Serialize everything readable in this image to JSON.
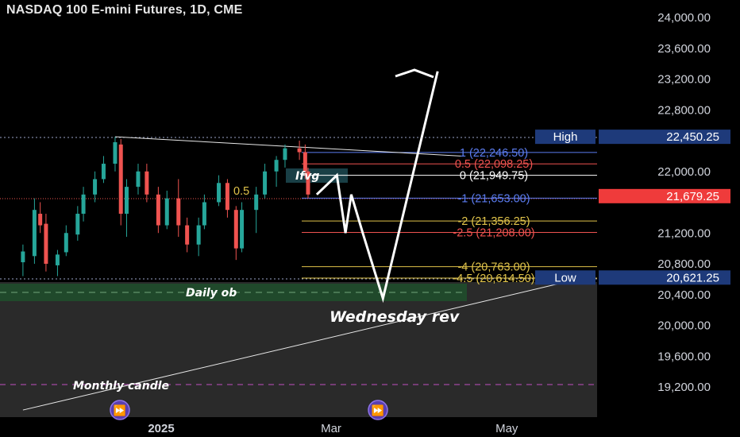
{
  "title": "NASDAQ 100 E-mini Futures, 1D, CME",
  "colors": {
    "background": "#000000",
    "pane": "#2a2a2a",
    "up": "#26a69a",
    "down": "#ef5350",
    "fib_blue": "#5b7cf0",
    "fib_white": "#ffffff",
    "fib_red": "#ef5350",
    "fib_yellow": "#e0c34a",
    "ob_zone": "#1f4d2b",
    "tag_blue": "#1e3a7a",
    "tag_red": "#ef3b3b"
  },
  "chart_data": {
    "type": "candlestick",
    "y_axis": {
      "min": 18900,
      "max": 24200,
      "ticks": [
        "24,000.00",
        "23,600.00",
        "23,200.00",
        "22,800.00",
        "22,000.00",
        "21,200.00",
        "20,800.00",
        "20,400.00",
        "20,000.00",
        "19,600.00",
        "19,200.00"
      ],
      "tick_values": [
        24000,
        23600,
        23200,
        22800,
        22000,
        21200,
        20800,
        20400,
        20000,
        19600,
        19200
      ]
    },
    "x_axis": {
      "labels": [
        "2025",
        "Mar",
        "May"
      ],
      "label_dates": [
        "2025-01-01",
        "2025-03-01",
        "2025-05-01"
      ],
      "range": [
        "2024-11-14",
        "2025-05-20"
      ]
    },
    "price_tags": [
      {
        "label": "High",
        "value_text": "22,450.25",
        "value": 22450.25,
        "style": "blue"
      },
      {
        "label": "",
        "value_text": "21,679.25",
        "value": 21679.25,
        "style": "red"
      },
      {
        "label": "Low",
        "value_text": "20,621.25",
        "value": 20621.25,
        "style": "blue"
      }
    ],
    "fib_levels": [
      {
        "text": "1 (22,246.50)",
        "value": 22246.5,
        "color": "blue"
      },
      {
        "text": "0.5 (22,098.25)",
        "value": 22098.25,
        "color": "red"
      },
      {
        "text": "0 (21,949.75)",
        "value": 21949.75,
        "color": "white"
      },
      {
        "text": "-1 (21,653.00)",
        "value": 21653.0,
        "color": "blue"
      },
      {
        "text": "-2 (21,356.25)",
        "value": 21356.25,
        "color": "yellow"
      },
      {
        "text": "-2.5 (21,208.00)",
        "value": 21208.0,
        "color": "red"
      },
      {
        "text": "-4 (20,763.00)",
        "value": 20763.0,
        "color": "yellow"
      },
      {
        "text": "-4.5 (20,614.50)",
        "value": 20614.5,
        "color": "yellow"
      }
    ],
    "annotations": [
      {
        "text": "Daily ob"
      },
      {
        "text": "Wednesday rev"
      },
      {
        "text": "Monthly candle"
      },
      {
        "text": "Ifvg"
      },
      {
        "text": "0.5"
      }
    ],
    "projection_path": [
      [
        "2025-02-24",
        21700
      ],
      [
        "2025-03-03",
        21950
      ],
      [
        "2025-03-06",
        21200
      ],
      [
        "2025-03-08",
        21700
      ],
      [
        "2025-03-12",
        21200
      ],
      [
        "2025-03-19",
        20350
      ],
      [
        "2025-04-07",
        23300
      ]
    ],
    "trendlines": [
      {
        "name": "resistance",
        "from": [
          "2024-12-16",
          22450
        ],
        "to": [
          "2025-04-15",
          22200
        ]
      },
      {
        "name": "support",
        "from": [
          "2024-11-14",
          18900
        ],
        "to": [
          "2025-05-20",
          20550
        ]
      }
    ],
    "candles": [
      {
        "date": "2024-11-14",
        "open": 20820,
        "high": 21050,
        "low": 20640,
        "close": 20960
      },
      {
        "date": "2024-11-18",
        "open": 20900,
        "high": 21650,
        "low": 20800,
        "close": 21500
      },
      {
        "date": "2024-11-20",
        "open": 21450,
        "high": 21600,
        "low": 21200,
        "close": 21300
      },
      {
        "date": "2024-11-22",
        "open": 21320,
        "high": 21450,
        "low": 20700,
        "close": 20800
      },
      {
        "date": "2024-11-26",
        "open": 20780,
        "high": 20980,
        "low": 20640,
        "close": 20920
      },
      {
        "date": "2024-11-29",
        "open": 20950,
        "high": 21300,
        "low": 20900,
        "close": 21200
      },
      {
        "date": "2024-12-03",
        "open": 21180,
        "high": 21550,
        "low": 21100,
        "close": 21450
      },
      {
        "date": "2024-12-05",
        "open": 21450,
        "high": 21800,
        "low": 21350,
        "close": 21700
      },
      {
        "date": "2024-12-09",
        "open": 21700,
        "high": 22000,
        "low": 21600,
        "close": 21900
      },
      {
        "date": "2024-12-12",
        "open": 21900,
        "high": 22200,
        "low": 21850,
        "close": 22100
      },
      {
        "date": "2024-12-16",
        "open": 22100,
        "high": 22450,
        "low": 22000,
        "close": 22380
      },
      {
        "date": "2024-12-18",
        "open": 22350,
        "high": 22420,
        "low": 21300,
        "close": 21450
      },
      {
        "date": "2024-12-20",
        "open": 21450,
        "high": 21900,
        "low": 21150,
        "close": 21800
      },
      {
        "date": "2024-12-24",
        "open": 21800,
        "high": 22100,
        "low": 21700,
        "close": 22000
      },
      {
        "date": "2024-12-27",
        "open": 22000,
        "high": 22100,
        "low": 21600,
        "close": 21700
      },
      {
        "date": "2024-12-31",
        "open": 21700,
        "high": 21800,
        "low": 21200,
        "close": 21300
      },
      {
        "date": "2025-01-03",
        "open": 21300,
        "high": 21750,
        "low": 21250,
        "close": 21650
      },
      {
        "date": "2025-01-07",
        "open": 21650,
        "high": 21900,
        "low": 21150,
        "close": 21300
      },
      {
        "date": "2025-01-10",
        "open": 21300,
        "high": 21400,
        "low": 20950,
        "close": 21050
      },
      {
        "date": "2025-01-14",
        "open": 21050,
        "high": 21400,
        "low": 20900,
        "close": 21300
      },
      {
        "date": "2025-01-16",
        "open": 21300,
        "high": 21700,
        "low": 21250,
        "close": 21600
      },
      {
        "date": "2025-01-21",
        "open": 21600,
        "high": 21950,
        "low": 21550,
        "close": 21850
      },
      {
        "date": "2025-01-24",
        "open": 21850,
        "high": 21900,
        "low": 21400,
        "close": 21500
      },
      {
        "date": "2025-01-27",
        "open": 21500,
        "high": 21550,
        "low": 20850,
        "close": 21000
      },
      {
        "date": "2025-01-29",
        "open": 21000,
        "high": 21600,
        "low": 20950,
        "close": 21500
      },
      {
        "date": "2025-02-03",
        "open": 21500,
        "high": 21800,
        "low": 21200,
        "close": 21700
      },
      {
        "date": "2025-02-06",
        "open": 21700,
        "high": 22100,
        "low": 21650,
        "close": 22000
      },
      {
        "date": "2025-02-10",
        "open": 22000,
        "high": 22200,
        "low": 21800,
        "close": 22150
      },
      {
        "date": "2025-02-13",
        "open": 22150,
        "high": 22350,
        "low": 22050,
        "close": 22300
      },
      {
        "date": "2025-02-18",
        "open": 22300,
        "high": 22400,
        "low": 22150,
        "close": 22250
      },
      {
        "date": "2025-02-20",
        "open": 22250,
        "high": 22350,
        "low": 21900,
        "close": 22000
      },
      {
        "date": "2025-02-21",
        "open": 22000,
        "high": 22050,
        "low": 21650,
        "close": 21700
      }
    ]
  }
}
